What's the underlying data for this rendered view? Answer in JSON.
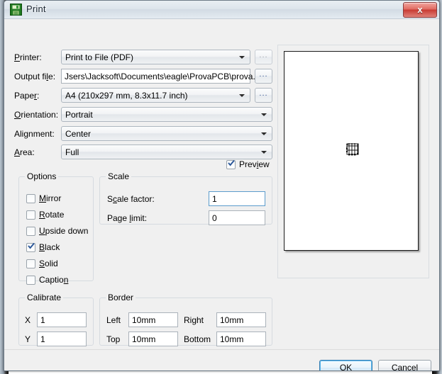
{
  "window": {
    "title": "Print",
    "icon": "floppy-disk-icon",
    "close_label": "x"
  },
  "fields": {
    "printer": {
      "label": "P",
      "label_key": "P",
      "label_rest": "rinter:",
      "value": "Print to File (PDF)"
    },
    "output_file": {
      "label_pre": "Output fi",
      "label_key": "l",
      "label_post": "e:",
      "value": "Jsers\\Jacksoft\\Documents\\eagle\\ProvaPCB\\prova.pdf"
    },
    "paper": {
      "label_pre": "Pape",
      "label_key": "r",
      "label_post": ":",
      "value": "A4 (210x297 mm, 8.3x11.7 inch)"
    },
    "orientation": {
      "label_key": "O",
      "label_post": "rientation:",
      "value": "Portrait"
    },
    "alignment": {
      "label_pre": "Ali",
      "label_key": "g",
      "label_post": "nment:",
      "value": "Center"
    },
    "area": {
      "label_key": "A",
      "label_post": "rea:",
      "value": "Full"
    }
  },
  "browse_buttons": {
    "dots": "...",
    "printer_enabled": false,
    "output_enabled": true,
    "paper_enabled": true
  },
  "preview_checkbox": {
    "label_pre": "Prev",
    "label_key": "i",
    "label_post": "ew",
    "checked": true
  },
  "options_group": {
    "title": "Options",
    "items": [
      {
        "pre": "",
        "key": "M",
        "post": "irror",
        "checked": false,
        "name": "mirror"
      },
      {
        "pre": "",
        "key": "R",
        "post": "otate",
        "checked": false,
        "name": "rotate"
      },
      {
        "pre": "",
        "key": "U",
        "post": "pside down",
        "checked": false,
        "name": "upside-down"
      },
      {
        "pre": "",
        "key": "B",
        "post": "lack",
        "checked": true,
        "name": "black"
      },
      {
        "pre": "",
        "key": "S",
        "post": "olid",
        "checked": false,
        "name": "solid"
      },
      {
        "pre": "Captio",
        "key": "n",
        "post": "",
        "checked": false,
        "name": "caption"
      }
    ]
  },
  "scale_group": {
    "title": "Scale",
    "scale_factor": {
      "label_pre": "S",
      "label_key": "c",
      "label_post": "ale factor:",
      "value": "1"
    },
    "page_limit": {
      "label_pre": "Page ",
      "label_key": "l",
      "label_post": "imit:",
      "value": "0"
    }
  },
  "calibrate_group": {
    "title": "Calibrate",
    "x": {
      "label": "X",
      "value": "1"
    },
    "y": {
      "label": "Y",
      "value": "1"
    }
  },
  "border_group": {
    "title": "Border",
    "left": {
      "label": "Left",
      "value": "10mm"
    },
    "right": {
      "label": "Right",
      "value": "10mm"
    },
    "top": {
      "label": "Top",
      "value": "10mm"
    },
    "bottom": {
      "label": "Bottom",
      "value": "10mm"
    }
  },
  "buttons": {
    "ok": "OK",
    "cancel": "Cancel"
  }
}
